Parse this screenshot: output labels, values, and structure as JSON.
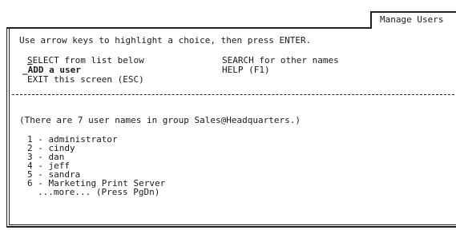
{
  "tab": {
    "title": "Manage Users"
  },
  "instructions": {
    "text": "Use arrow keys to highlight a choice, then press ENTER."
  },
  "menu": {
    "items": [
      {
        "label": "SELECT from list below"
      },
      {
        "label": "ADD a user"
      },
      {
        "label": "EXIT this screen (ESC)"
      },
      {
        "label": "SEARCH for other names"
      },
      {
        "label": "HELP (F1)"
      }
    ]
  },
  "group_info": {
    "text": "(There are 7 user names in group Sales@Headquarters.)"
  },
  "users": {
    "items": [
      {
        "index": "1",
        "name": "administrator"
      },
      {
        "index": "2",
        "name": "cindy"
      },
      {
        "index": "3",
        "name": "dan"
      },
      {
        "index": "4",
        "name": "jeff"
      },
      {
        "index": "5",
        "name": "sandra"
      },
      {
        "index": "6",
        "name": "Marketing Print Server"
      }
    ],
    "more_text": "...more... (Press PgDn)"
  },
  "colors": {
    "background": "#ffffff",
    "text": "#1a1a1a",
    "border": "#222222"
  }
}
